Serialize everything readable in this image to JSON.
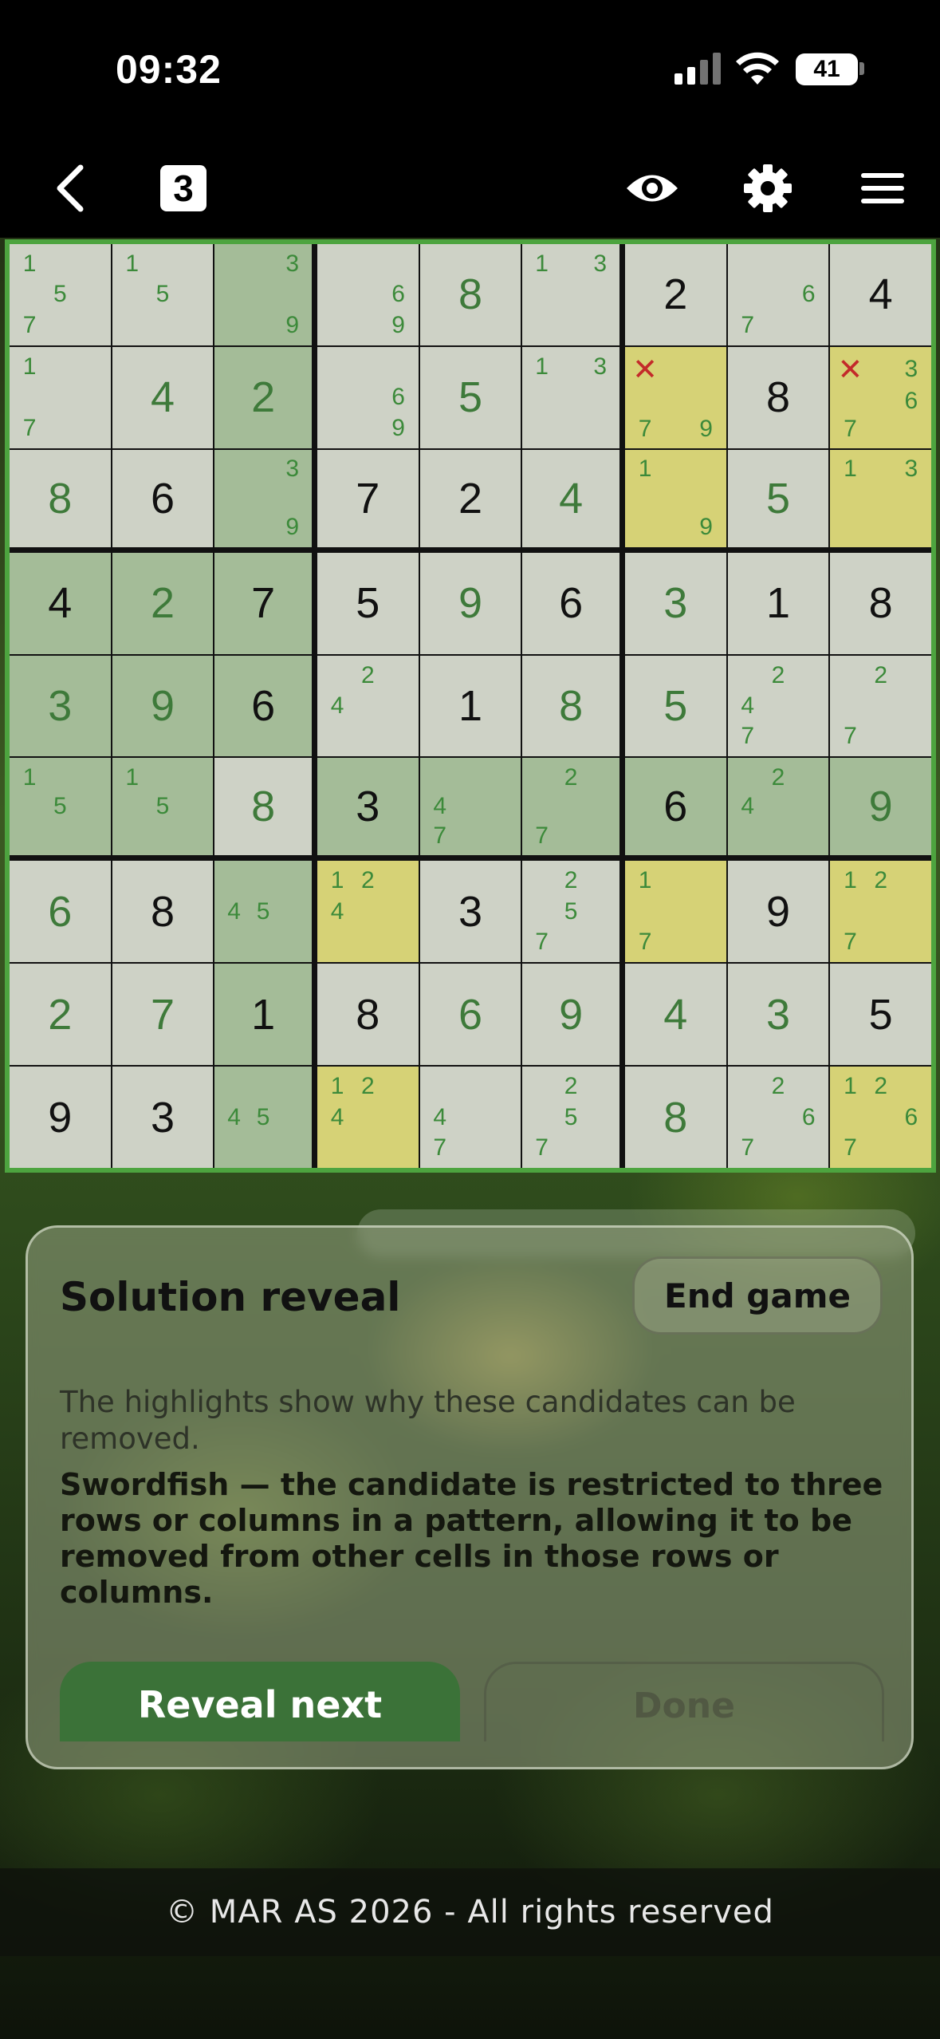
{
  "status_bar": {
    "time": "09:32",
    "battery": "41",
    "icons": [
      "signal-icon",
      "wifi-icon",
      "battery-icon"
    ]
  },
  "nav": {
    "back_icon": "chevron-left-icon",
    "level_badge": "3",
    "icons": [
      "eye-icon",
      "gear-icon",
      "hamburger-menu-icon"
    ]
  },
  "colors": {
    "grid_border": "#4da43f",
    "user_digit": "#3e7a3a",
    "given_digit": "#111111",
    "candidate": "#3c8a3a",
    "eliminated_candidate": "#c32a2a",
    "highlight_yellow": "#ece882",
    "primary_button": "#3b7238"
  },
  "board": {
    "rows": [
      [
        {
          "c": [
            "1",
            "",
            "",
            "",
            "5",
            "",
            "7",
            "",
            ""
          ]
        },
        {
          "c": [
            "1",
            "",
            "",
            "",
            "5",
            "",
            "",
            "",
            ""
          ]
        },
        {
          "c": [
            "",
            "",
            "3",
            "",
            "",
            "",
            "",
            "",
            "9"
          ],
          "s": true
        },
        {
          "c": [
            "",
            "",
            "",
            "",
            "",
            "6",
            "",
            "",
            "9"
          ]
        },
        {
          "v": "8",
          "u": true
        },
        {
          "c": [
            "1",
            "",
            "3",
            "",
            "",
            "",
            "",
            "",
            ""
          ]
        },
        {
          "v": "2"
        },
        {
          "c": [
            "",
            "",
            "",
            "",
            "",
            "6",
            "7",
            "",
            ""
          ]
        },
        {
          "v": "4"
        }
      ],
      [
        {
          "c": [
            "1",
            "",
            "",
            "",
            "",
            "",
            "7",
            "",
            ""
          ]
        },
        {
          "v": "4",
          "u": true
        },
        {
          "v": "2",
          "u": true,
          "s": true
        },
        {
          "c": [
            "",
            "",
            "",
            "",
            "",
            "6",
            "",
            "",
            "9"
          ]
        },
        {
          "v": "5",
          "u": true
        },
        {
          "c": [
            "1",
            "",
            "3",
            "",
            "",
            "",
            "",
            "",
            ""
          ]
        },
        {
          "c": [
            "x",
            "",
            "",
            "",
            "",
            "",
            "7",
            "",
            "9"
          ],
          "y": true
        },
        {
          "v": "8"
        },
        {
          "c": [
            "x",
            "",
            "3",
            "",
            "",
            "6",
            "7",
            "",
            ""
          ],
          "y": true
        }
      ],
      [
        {
          "v": "8",
          "u": true
        },
        {
          "v": "6"
        },
        {
          "c": [
            "",
            "",
            "3",
            "",
            "",
            "",
            "",
            "",
            "9"
          ],
          "s": true
        },
        {
          "v": "7"
        },
        {
          "v": "2"
        },
        {
          "v": "4",
          "u": true
        },
        {
          "c": [
            "1",
            "",
            "",
            "",
            "",
            "",
            "",
            "",
            "9"
          ],
          "y": true
        },
        {
          "v": "5",
          "u": true
        },
        {
          "c": [
            "1",
            "",
            "3",
            "",
            "",
            "",
            "",
            "",
            ""
          ],
          "y": true
        }
      ],
      [
        {
          "v": "4",
          "s": true
        },
        {
          "v": "2",
          "u": true,
          "s": true
        },
        {
          "v": "7",
          "s": true
        },
        {
          "v": "5"
        },
        {
          "v": "9",
          "u": true
        },
        {
          "v": "6"
        },
        {
          "v": "3",
          "u": true
        },
        {
          "v": "1"
        },
        {
          "v": "8"
        }
      ],
      [
        {
          "v": "3",
          "u": true,
          "s": true
        },
        {
          "v": "9",
          "u": true,
          "s": true
        },
        {
          "v": "6",
          "s": true
        },
        {
          "c": [
            "",
            "2",
            "",
            "4",
            "",
            "",
            "",
            "",
            ""
          ]
        },
        {
          "v": "1"
        },
        {
          "v": "8",
          "u": true
        },
        {
          "v": "5",
          "u": true
        },
        {
          "c": [
            "",
            "2",
            "",
            "4",
            "",
            "",
            "7",
            "",
            ""
          ]
        },
        {
          "c": [
            "",
            "2",
            "",
            "",
            "",
            "",
            "7",
            "",
            ""
          ]
        }
      ],
      [
        {
          "c": [
            "1",
            "",
            "",
            "",
            "5",
            "",
            "",
            "",
            ""
          ],
          "s": true
        },
        {
          "c": [
            "1",
            "",
            "",
            "",
            "5",
            "",
            "",
            "",
            ""
          ],
          "s": true
        },
        {
          "v": "8",
          "u": true
        },
        {
          "v": "3",
          "s": true
        },
        {
          "c": [
            "",
            "",
            "",
            "4",
            "",
            "",
            "7",
            "",
            ""
          ],
          "s": true
        },
        {
          "c": [
            "",
            "2",
            "",
            "",
            "",
            "",
            "7",
            "",
            ""
          ],
          "s": true
        },
        {
          "v": "6",
          "s": true
        },
        {
          "c": [
            "",
            "2",
            "",
            "4",
            "",
            "",
            "",
            "",
            ""
          ],
          "s": true
        },
        {
          "v": "9",
          "u": true,
          "s": true
        }
      ],
      [
        {
          "v": "6",
          "u": true
        },
        {
          "v": "8"
        },
        {
          "c": [
            "",
            "",
            "",
            "4",
            "5",
            "",
            "",
            "",
            ""
          ],
          "s": true
        },
        {
          "c": [
            "1",
            "2",
            "",
            "4",
            "",
            "",
            "",
            "",
            ""
          ],
          "y": true
        },
        {
          "v": "3"
        },
        {
          "c": [
            "",
            "2",
            "",
            "",
            "5",
            "",
            "7",
            "",
            ""
          ]
        },
        {
          "c": [
            "1",
            "",
            "",
            "",
            "",
            "",
            "7",
            "",
            ""
          ],
          "y": true
        },
        {
          "v": "9"
        },
        {
          "c": [
            "1",
            "2",
            "",
            "",
            "",
            "",
            "7",
            "",
            ""
          ],
          "y": true
        }
      ],
      [
        {
          "v": "2",
          "u": true
        },
        {
          "v": "7",
          "u": true
        },
        {
          "v": "1",
          "s": true
        },
        {
          "v": "8"
        },
        {
          "v": "6",
          "u": true
        },
        {
          "v": "9",
          "u": true
        },
        {
          "v": "4",
          "u": true
        },
        {
          "v": "3",
          "u": true
        },
        {
          "v": "5"
        }
      ],
      [
        {
          "v": "9"
        },
        {
          "v": "3"
        },
        {
          "c": [
            "",
            "",
            "",
            "4",
            "5",
            "",
            "",
            "",
            ""
          ],
          "s": true
        },
        {
          "c": [
            "1",
            "2",
            "",
            "4",
            "",
            "",
            "",
            "",
            ""
          ],
          "y": true
        },
        {
          "c": [
            "",
            "",
            "",
            "4",
            "",
            "",
            "7",
            "",
            ""
          ]
        },
        {
          "c": [
            "",
            "2",
            "",
            "",
            "5",
            "",
            "7",
            "",
            ""
          ]
        },
        {
          "v": "8",
          "u": true
        },
        {
          "c": [
            "",
            "2",
            "",
            "",
            "",
            "6",
            "7",
            "",
            ""
          ]
        },
        {
          "c": [
            "1",
            "2",
            "",
            "",
            "",
            "6",
            "7",
            "",
            ""
          ],
          "y": true
        }
      ]
    ]
  },
  "panel": {
    "title": "Solution reveal",
    "end_game_label": "End game",
    "description": "The highlights show why these candidates can be removed.",
    "strategy": "Swordfish — the candidate is restricted to three rows or columns in a pattern, allowing it to be removed from other cells in those rows or columns.",
    "reveal_next_label": "Reveal next",
    "done_label": "Done"
  },
  "footer": {
    "text": "© MAR AS 2026 - All rights reserved"
  }
}
